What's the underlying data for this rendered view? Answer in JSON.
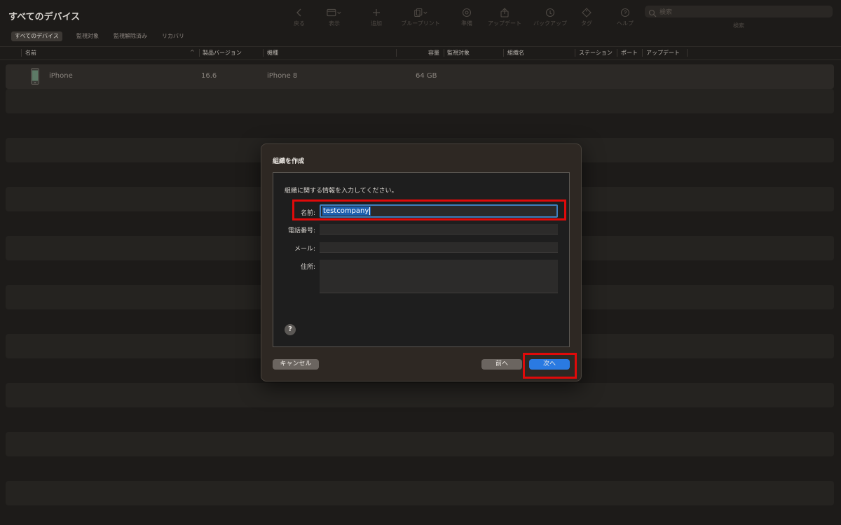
{
  "window": {
    "title": "すべてのデバイス"
  },
  "toolbar": {
    "items": [
      {
        "label": "戻る",
        "icon": "chevron-left-icon"
      },
      {
        "label": "表示",
        "icon": "view-icon"
      },
      {
        "label": "追加",
        "icon": "plus-icon"
      },
      {
        "label": "ブループリント",
        "icon": "blueprint-icon"
      },
      {
        "label": "準備",
        "icon": "prepare-icon"
      },
      {
        "label": "アップデート",
        "icon": "update-icon"
      },
      {
        "label": "バックアップ",
        "icon": "backup-icon"
      },
      {
        "label": "タグ",
        "icon": "tag-icon"
      },
      {
        "label": "ヘルプ",
        "icon": "help-icon"
      }
    ],
    "search_placeholder": "検索",
    "search_label": "検索"
  },
  "filter_tabs": [
    {
      "label": "すべてのデバイス",
      "active": true
    },
    {
      "label": "監視対象",
      "active": false
    },
    {
      "label": "監視解除済み",
      "active": false
    },
    {
      "label": "リカバリ",
      "active": false
    }
  ],
  "table": {
    "columns": [
      "名前",
      "製品バージョン",
      "機種",
      "容量",
      "監視対象",
      "組織名",
      "ステーション",
      "ポート",
      "アップデート"
    ],
    "sort_indicator": "^",
    "rows": [
      {
        "name": "iPhone",
        "version": "16.6",
        "model": "iPhone 8",
        "capacity": "64 GB"
      }
    ]
  },
  "dialog": {
    "title": "組織を作成",
    "instruction": "組織に関する情報を入力してください。",
    "fields": {
      "name": {
        "label": "名前:",
        "value": "testcompany"
      },
      "phone": {
        "label": "電話番号:",
        "value": ""
      },
      "email": {
        "label": "メール:",
        "value": ""
      },
      "address": {
        "label": "住所:",
        "value": ""
      }
    },
    "help_label": "?",
    "buttons": {
      "cancel": "キャンセル",
      "prev": "前へ",
      "next": "次へ"
    }
  },
  "colors": {
    "background": "#1d1b19",
    "dialog_bg": "#2e2823",
    "accent": "#2a7ae2",
    "focus_ring": "#3f7fbf",
    "highlight": "#e00a0a"
  }
}
